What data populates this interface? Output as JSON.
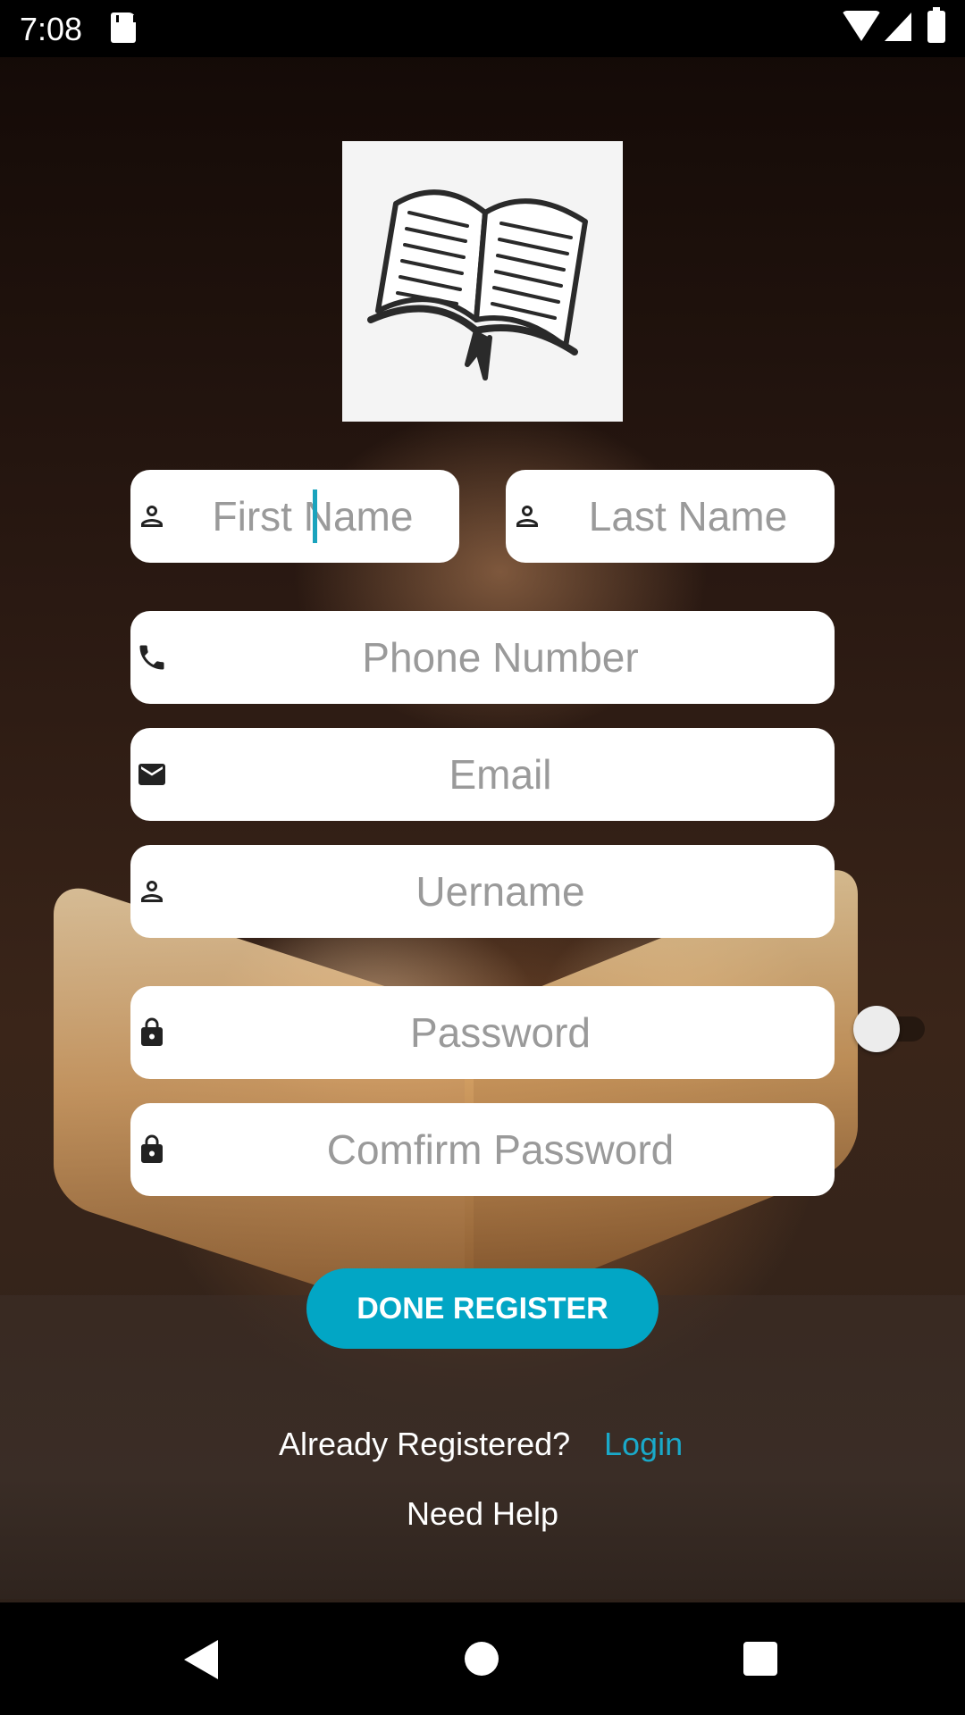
{
  "status_bar": {
    "time": "7:08"
  },
  "form": {
    "first_name_placeholder": "First Name",
    "last_name_placeholder": "Last Name",
    "phone_placeholder": "Phone Number",
    "email_placeholder": "Email",
    "username_placeholder": "Uername",
    "password_placeholder": "Password",
    "confirm_password_placeholder": "Comfirm Password",
    "show_password_toggle_on": false
  },
  "actions": {
    "register_label": "DONE REGISTER",
    "already_registered": "Already Registered?",
    "login_label": "Login",
    "help_label": "Need Help"
  },
  "colors": {
    "accent": "#02a6c5",
    "link": "#1aa9c9",
    "field_bg": "#ffffff",
    "placeholder": "#9a9a9a"
  },
  "icons": [
    "book-logo",
    "person-icon",
    "phone-icon",
    "mail-icon",
    "lock-icon"
  ]
}
